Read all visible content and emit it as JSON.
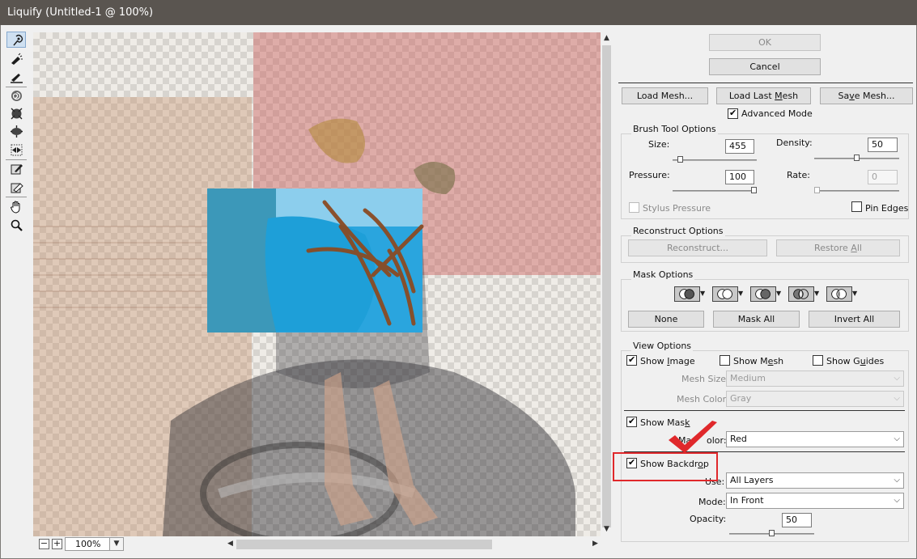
{
  "window": {
    "title": "Liquify (Untitled-1 @ 100%)"
  },
  "toolbar": {
    "tools": [
      "forward-warp-tool",
      "reconstruct-tool",
      "smooth-tool",
      "twirl-clockwise-tool",
      "pucker-tool",
      "bloat-tool",
      "push-left-tool",
      "freeze-mask-tool",
      "thaw-mask-tool",
      "hand-tool",
      "zoom-tool"
    ]
  },
  "canvas": {
    "zoom": "100%"
  },
  "buttons": {
    "ok": "OK",
    "cancel": "Cancel"
  },
  "mesh": {
    "load_pre": "Load Mesh...",
    "load_last_pre": "Load Last ",
    "load_last_u": "M",
    "load_last_post": "esh",
    "save_pre": "Sa",
    "save_u": "v",
    "save_post": "e Mesh..."
  },
  "advanced_mode": {
    "label": "Advanced Mode",
    "checked": true
  },
  "brush": {
    "title": "Brush Tool Options",
    "size_label": "Size:",
    "size": "455",
    "size_level": 0.06,
    "density_label": "Density:",
    "density": "50",
    "density_level": 0.5,
    "pressure_label": "Pressure:",
    "pressure": "100",
    "pressure_level": 1.0,
    "rate_label": "Rate:",
    "rate": "0",
    "rate_level": 0.0,
    "stylus_label": "Stylus Pressure",
    "stylus_checked": false,
    "pin_label": "Pin Edges",
    "pin_checked": false
  },
  "reconstruct": {
    "title": "Reconstruct Options",
    "reconstruct_btn": "Reconstruct...",
    "restore_pre": "Restore ",
    "restore_u": "A",
    "restore_post": "ll"
  },
  "mask": {
    "title": "Mask Options",
    "none": "None",
    "mask_all": "Mask All",
    "invert_all": "Invert All"
  },
  "view": {
    "title": "View Options",
    "show_image_pre": "Show ",
    "show_image_u": "I",
    "show_image_post": "mage",
    "show_image_checked": true,
    "show_mesh_pre": "Show M",
    "show_mesh_u": "e",
    "show_mesh_post": "sh",
    "show_mesh_checked": false,
    "show_guides_pre": "Show G",
    "show_guides_u": "u",
    "show_guides_post": "ides",
    "show_guides_checked": false,
    "mesh_size_label": "Mesh Size:",
    "mesh_size": "Medium",
    "mesh_color_label": "Mesh Color:",
    "mesh_color": "Gray",
    "show_mask_pre": "Show Mas",
    "show_mask_u": "k",
    "show_mask_post": "",
    "show_mask_checked": true,
    "mask_color_pre": "Mas",
    "mask_color_post": "olor:",
    "mask_color": "Red",
    "show_backdrop_pre": "Show Backdr",
    "show_backdrop_u": "o",
    "show_backdrop_post": "p",
    "show_backdrop_checked": true,
    "use_label": "Use:",
    "use": "All Layers",
    "mode_label": "Mode:",
    "mode": "In Front",
    "opacity_label": "Opacity:",
    "opacity": "50",
    "opacity_level": 0.5
  },
  "annotation": {
    "highlight_color": "#e0282b"
  }
}
